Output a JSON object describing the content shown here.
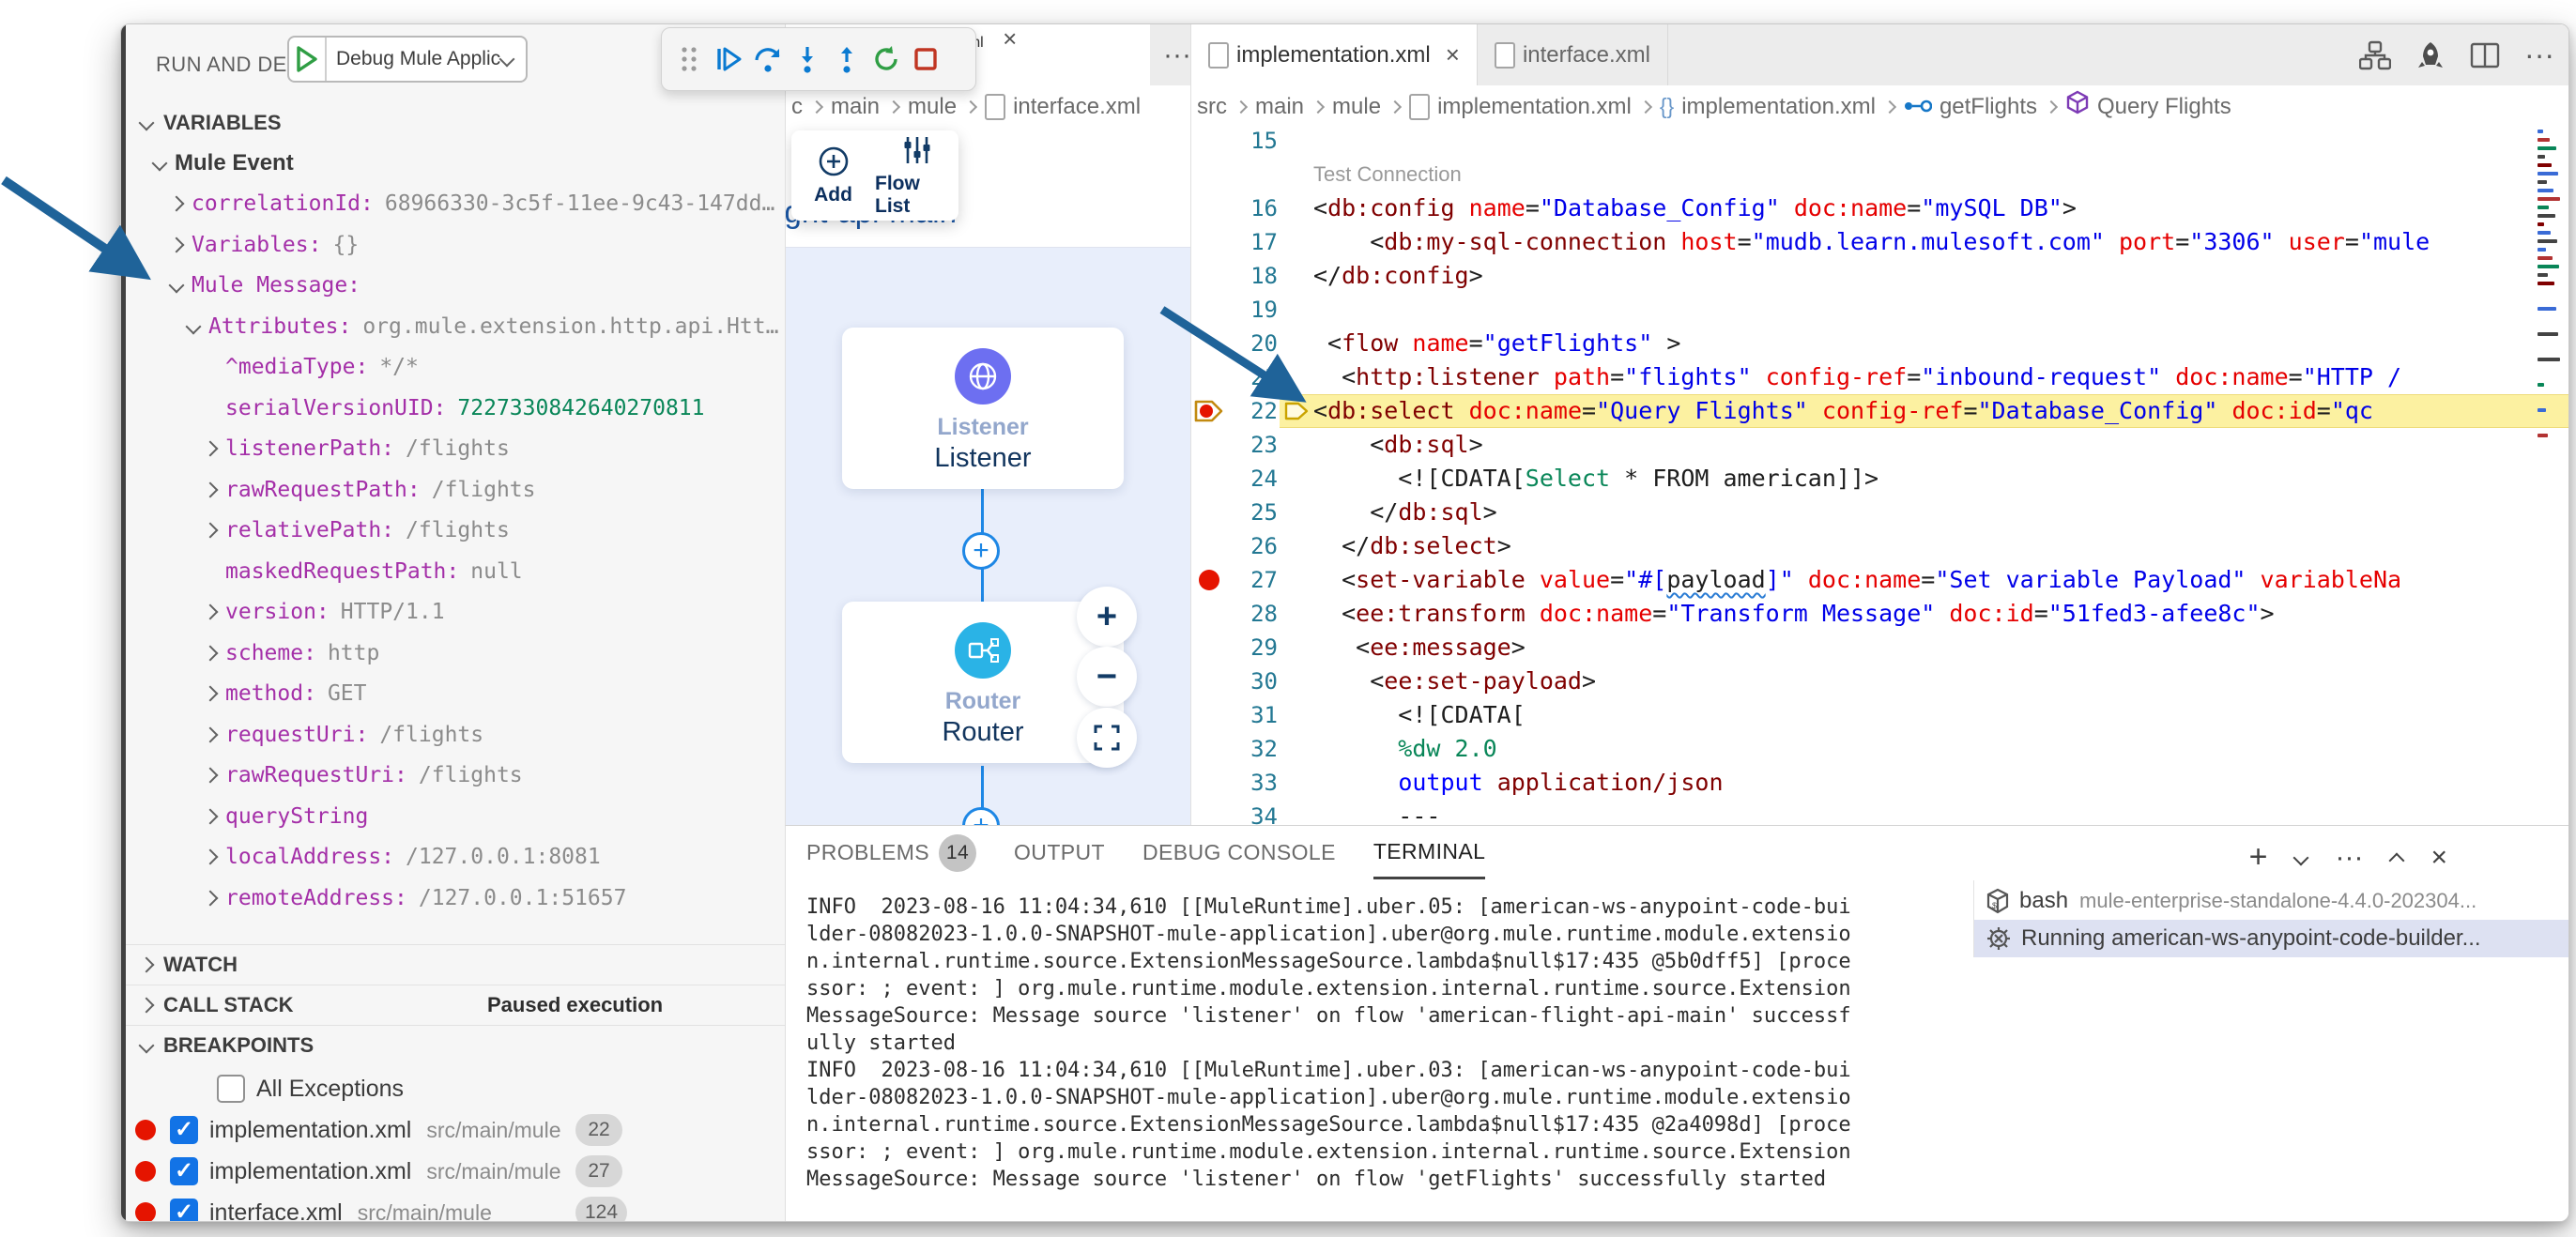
{
  "colors": {
    "accent_blue": "#1f6399",
    "breakpoint_red": "#e51400",
    "listener_purple": "#6d6ff1",
    "router_cyan": "#2ab3e6",
    "current_line": "#fcf1a1"
  },
  "debug_toolbar": {
    "buttons": [
      "drag-handle",
      "continue",
      "step-over",
      "step-into",
      "step-out",
      "restart",
      "stop"
    ]
  },
  "sidebar": {
    "title": "RUN AND DEBUG",
    "launch_config": "Debug Mule Applicatic",
    "sections": {
      "variables": "VARIABLES",
      "watch": "WATCH",
      "call_stack": "CALL STACK",
      "breakpoints": "BREAKPOINTS"
    },
    "call_stack_status": "Paused execution",
    "variables_tree": [
      {
        "depth": 0,
        "expand": "open",
        "name": "Mule Event",
        "value": "",
        "bold": true
      },
      {
        "depth": 1,
        "expand": "closed",
        "name": "correlationId:",
        "value": "68966330-3c5f-11ee-9c43-147dd…"
      },
      {
        "depth": 1,
        "expand": "closed",
        "name": "Variables:",
        "value": "{}"
      },
      {
        "depth": 1,
        "expand": "open",
        "name": "Mule Message:",
        "value": ""
      },
      {
        "depth": 2,
        "expand": "open",
        "name": "Attributes:",
        "value": "org.mule.extension.http.api.Htt…"
      },
      {
        "depth": 3,
        "expand": "none",
        "name": "^mediaType:",
        "value": "*/*"
      },
      {
        "depth": 3,
        "expand": "none",
        "name": "serialVersionUID:",
        "value": "7227330842640270811",
        "value_color": "green"
      },
      {
        "depth": 3,
        "expand": "closed",
        "name": "listenerPath:",
        "value": "/flights"
      },
      {
        "depth": 3,
        "expand": "closed",
        "name": "rawRequestPath:",
        "value": "/flights"
      },
      {
        "depth": 3,
        "expand": "closed",
        "name": "relativePath:",
        "value": "/flights"
      },
      {
        "depth": 3,
        "expand": "none",
        "name": "maskedRequestPath:",
        "value": "null"
      },
      {
        "depth": 3,
        "expand": "closed",
        "name": "version:",
        "value": "HTTP/1.1"
      },
      {
        "depth": 3,
        "expand": "closed",
        "name": "scheme:",
        "value": "http"
      },
      {
        "depth": 3,
        "expand": "closed",
        "name": "method:",
        "value": "GET"
      },
      {
        "depth": 3,
        "expand": "closed",
        "name": "requestUri:",
        "value": "/flights"
      },
      {
        "depth": 3,
        "expand": "closed",
        "name": "rawRequestUri:",
        "value": "/flights"
      },
      {
        "depth": 3,
        "expand": "closed",
        "name": "queryString",
        "value": ""
      },
      {
        "depth": 3,
        "expand": "closed",
        "name": "localAddress:",
        "value": "/127.0.0.1:8081"
      },
      {
        "depth": 3,
        "expand": "closed",
        "name": "remoteAddress:",
        "value": "/127.0.0.1:51657"
      }
    ],
    "breakpoints": {
      "all_exceptions_label": "All Exceptions",
      "items": [
        {
          "file": "implementation.xml",
          "path": "src/main/mule",
          "line": "22"
        },
        {
          "file": "implementation.xml",
          "path": "src/main/mule",
          "line": "27"
        },
        {
          "file": "interface.xml",
          "path": "src/main/mule",
          "line": "124"
        }
      ]
    }
  },
  "flow_designer": {
    "tab_label": "interface.xml",
    "more_label": "⋯",
    "breadcrumb": [
      "c",
      "main",
      "mule",
      "interface.xml"
    ],
    "toolbar": {
      "add_label": "Add",
      "flow_list_label": "Flow List"
    },
    "flow_title": "american-flight-api-main",
    "nodes": [
      {
        "type": "Listener",
        "name": "Listener"
      },
      {
        "type": "Router",
        "name": "Router"
      }
    ],
    "zoom_controls": [
      "zoom-in",
      "zoom-out",
      "fit-to-screen"
    ]
  },
  "editor": {
    "tabs": [
      {
        "label": "implementation.xml",
        "active": true,
        "close": true
      },
      {
        "label": "interface.xml",
        "active": false,
        "close": false
      }
    ],
    "breadcrumb": [
      {
        "label": "src"
      },
      {
        "label": "main"
      },
      {
        "label": "mule"
      },
      {
        "label": "implementation.xml",
        "icon": "file"
      },
      {
        "label": "implementation.xml",
        "icon": "braces"
      },
      {
        "label": "getFlights",
        "icon": "flow"
      },
      {
        "label": "Query Flights",
        "icon": "cube"
      }
    ],
    "codelens": "Test Connection",
    "lines": [
      {
        "n": 15,
        "t": []
      },
      {
        "lens": true
      },
      {
        "n": 16,
        "t": [
          [
            "p",
            "<"
          ],
          [
            "t",
            "db:config"
          ],
          [
            "p",
            " "
          ],
          [
            "a",
            "name"
          ],
          [
            "p",
            "="
          ],
          [
            "v",
            "\"Database_Config\""
          ],
          [
            "p",
            " "
          ],
          [
            "a",
            "doc:name"
          ],
          [
            "p",
            "="
          ],
          [
            "v",
            "\"mySQL DB\""
          ],
          [
            "p",
            ">"
          ]
        ]
      },
      {
        "n": 17,
        "t": [
          [
            "p",
            "    <"
          ],
          [
            "t",
            "db:my-sql-connection"
          ],
          [
            "p",
            " "
          ],
          [
            "a",
            "host"
          ],
          [
            "p",
            "="
          ],
          [
            "v",
            "\"mudb.learn.mulesoft.com\""
          ],
          [
            "p",
            " "
          ],
          [
            "a",
            "port"
          ],
          [
            "p",
            "="
          ],
          [
            "v",
            "\"3306\""
          ],
          [
            "p",
            " "
          ],
          [
            "a",
            "user"
          ],
          [
            "p",
            "="
          ],
          [
            "v",
            "\"mule"
          ]
        ]
      },
      {
        "n": 18,
        "t": [
          [
            "p",
            "</"
          ],
          [
            "t",
            "db:config"
          ],
          [
            "p",
            ">"
          ]
        ]
      },
      {
        "n": 19,
        "t": []
      },
      {
        "n": 20,
        "t": [
          [
            "p",
            " <"
          ],
          [
            "t",
            "flow"
          ],
          [
            "p",
            " "
          ],
          [
            "a",
            "name"
          ],
          [
            "p",
            "="
          ],
          [
            "v",
            "\"getFlights\""
          ],
          [
            "p",
            " >"
          ]
        ]
      },
      {
        "n": 21,
        "t": [
          [
            "p",
            "  <"
          ],
          [
            "t",
            "http:listener"
          ],
          [
            "p",
            " "
          ],
          [
            "a",
            "path"
          ],
          [
            "p",
            "="
          ],
          [
            "v",
            "\"flights\""
          ],
          [
            "p",
            " "
          ],
          [
            "a",
            "config-ref"
          ],
          [
            "p",
            "="
          ],
          [
            "v",
            "\"inbound-request\""
          ],
          [
            "p",
            " "
          ],
          [
            "a",
            "doc:name"
          ],
          [
            "p",
            "="
          ],
          [
            "v",
            "\"HTTP /"
          ]
        ]
      },
      {
        "n": 22,
        "current": true,
        "marker": "paused-breakpoint",
        "t": [
          [
            "p",
            "<"
          ],
          [
            "t",
            "db:select"
          ],
          [
            "p",
            " "
          ],
          [
            "a",
            "doc:name"
          ],
          [
            "p",
            "="
          ],
          [
            "v",
            "\"Query Flights\""
          ],
          [
            "p",
            " "
          ],
          [
            "a",
            "config-ref"
          ],
          [
            "p",
            "="
          ],
          [
            "v",
            "\"Database_Config\""
          ],
          [
            "p",
            " "
          ],
          [
            "a",
            "doc:id"
          ],
          [
            "p",
            "="
          ],
          [
            "v",
            "\"qc"
          ]
        ]
      },
      {
        "n": 23,
        "t": [
          [
            "p",
            "    <"
          ],
          [
            "t",
            "db:sql"
          ],
          [
            "p",
            ">"
          ]
        ]
      },
      {
        "n": 24,
        "t": [
          [
            "p",
            "      <![CDATA["
          ],
          [
            "g",
            "Select"
          ],
          [
            "p",
            " * FROM american]]>"
          ]
        ]
      },
      {
        "n": 25,
        "t": [
          [
            "p",
            "    </"
          ],
          [
            "t",
            "db:sql"
          ],
          [
            "p",
            ">"
          ]
        ]
      },
      {
        "n": 26,
        "t": [
          [
            "p",
            "  </"
          ],
          [
            "t",
            "db:select"
          ],
          [
            "p",
            ">"
          ]
        ]
      },
      {
        "n": 27,
        "bp": true,
        "t": [
          [
            "p",
            "  <"
          ],
          [
            "t",
            "set-variable"
          ],
          [
            "p",
            " "
          ],
          [
            "a",
            "value"
          ],
          [
            "p",
            "="
          ],
          [
            "v",
            "\"#["
          ],
          [
            "w",
            "payload"
          ],
          [
            "v",
            "]\""
          ],
          [
            "p",
            " "
          ],
          [
            "a",
            "doc:name"
          ],
          [
            "p",
            "="
          ],
          [
            "v",
            "\"Set variable Payload\""
          ],
          [
            "p",
            " "
          ],
          [
            "a",
            "variableNa"
          ]
        ]
      },
      {
        "n": 28,
        "t": [
          [
            "p",
            "  <"
          ],
          [
            "t",
            "ee:transform"
          ],
          [
            "p",
            " "
          ],
          [
            "a",
            "doc:name"
          ],
          [
            "p",
            "="
          ],
          [
            "v",
            "\"Transform Message\""
          ],
          [
            "p",
            " "
          ],
          [
            "a",
            "doc:id"
          ],
          [
            "p",
            "="
          ],
          [
            "v",
            "\"51fed3-afee8c\""
          ],
          [
            "p",
            ">"
          ]
        ]
      },
      {
        "n": 29,
        "t": [
          [
            "p",
            "   <"
          ],
          [
            "t",
            "ee:message"
          ],
          [
            "p",
            ">"
          ]
        ]
      },
      {
        "n": 30,
        "t": [
          [
            "p",
            "    <"
          ],
          [
            "t",
            "ee:set-payload"
          ],
          [
            "p",
            ">"
          ]
        ]
      },
      {
        "n": 31,
        "t": [
          [
            "p",
            "      <![CDATA["
          ]
        ]
      },
      {
        "n": 32,
        "t": [
          [
            "g",
            "      %dw 2.0"
          ]
        ]
      },
      {
        "n": 33,
        "t": [
          [
            "p",
            "      "
          ],
          [
            "k",
            "output"
          ],
          [
            "p",
            " "
          ],
          [
            "m",
            "application/json"
          ]
        ]
      },
      {
        "n": 34,
        "t": [
          [
            "p",
            "      ---"
          ]
        ]
      }
    ]
  },
  "panel": {
    "tabs": [
      {
        "label": "PROBLEMS",
        "badge": "14"
      },
      {
        "label": "OUTPUT"
      },
      {
        "label": "DEBUG CONSOLE"
      },
      {
        "label": "TERMINAL",
        "active": true
      }
    ],
    "terminal_lines": [
      "INFO  2023-08-16 11:04:34,610 [[MuleRuntime].uber.05: [american-ws-anypoint-code-bui",
      "lder-08082023-1.0.0-SNAPSHOT-mule-application].uber@org.mule.runtime.module.extensio",
      "n.internal.runtime.source.ExtensionMessageSource.lambda$null$17:435 @5b0dff5] [proce",
      "ssor: ; event: ] org.mule.runtime.module.extension.internal.runtime.source.Extension",
      "MessageSource: Message source 'listener' on flow 'american-flight-api-main' successf",
      "ully started",
      "INFO  2023-08-16 11:04:34,610 [[MuleRuntime].uber.03: [american-ws-anypoint-code-bui",
      "lder-08082023-1.0.0-SNAPSHOT-mule-application].uber@org.mule.runtime.module.extensio",
      "n.internal.runtime.source.ExtensionMessageSource.lambda$null$17:435 @2a4098d] [proce",
      "ssor: ; event: ] org.mule.runtime.module.extension.internal.runtime.source.Extension",
      "MessageSource: Message source 'listener' on flow 'getFlights' successfully started"
    ],
    "terminal_list": [
      {
        "icon": "terminal-box",
        "name": "bash",
        "desc": "mule-enterprise-standalone-4.4.0-202304...",
        "selected": false
      },
      {
        "icon": "debug-process",
        "name": "Running american-ws-anypoint-code-builder...",
        "desc": "",
        "selected": true
      }
    ]
  }
}
